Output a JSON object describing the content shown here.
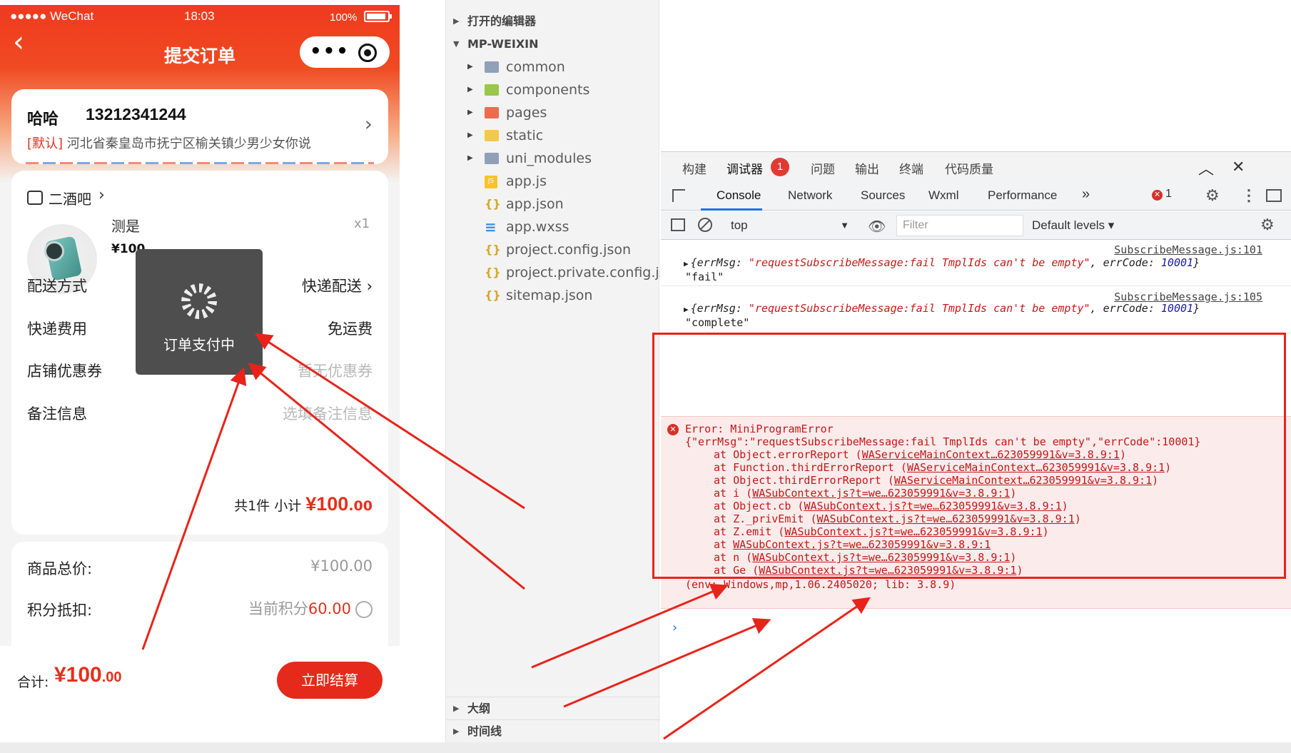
{
  "phone": {
    "status_left": "●●●●● WeChat",
    "status_time": "18:03",
    "status_battery": "100%",
    "nav_back": "‹",
    "nav_title": "提交订单",
    "capsule_more": "•••",
    "address": {
      "name": "哈哈",
      "phone": "13212341244",
      "default_tag": "[默认]",
      "detail": "河北省秦皇岛市抚宁区榆关镇少男少女你说",
      "chevron": "›"
    },
    "shop": {
      "name": "二酒吧",
      "chevron": "›"
    },
    "product": {
      "name": "测是",
      "qty": "x1",
      "price": "¥100"
    },
    "rows": [
      {
        "label": "配送方式",
        "value": "快递配送 ›"
      },
      {
        "label": "快递费用",
        "value": "免运费"
      },
      {
        "label": "店铺优惠券",
        "value": "暂无优惠券"
      },
      {
        "label": "备注信息",
        "value": "选填备注信息"
      }
    ],
    "subtotal": {
      "prefix": "共1件 小计 ",
      "amount": "¥100",
      "decimal": ".00"
    },
    "totals": [
      {
        "label": "商品总价:",
        "value": "¥100.00"
      },
      {
        "label": "积分抵扣:",
        "value_prefix": "当前积分",
        "value_points": "60.00"
      }
    ],
    "footer": {
      "label": "合计:",
      "amount": "¥100",
      "decimal": ".00",
      "pay_button": "立即结算"
    },
    "toast": {
      "text": "订单支付中"
    }
  },
  "explorer": {
    "sections": {
      "open_editors": "打开的编辑器",
      "project": "MP-WEIXIN",
      "outline": "大纲",
      "timeline": "时间线"
    },
    "items": [
      {
        "label": "common",
        "icon": "folder-icon",
        "folder": true
      },
      {
        "label": "components",
        "icon": "components-folder-icon",
        "folder": true
      },
      {
        "label": "pages",
        "icon": "pages-folder-icon",
        "folder": true
      },
      {
        "label": "static",
        "icon": "static-folder-icon",
        "folder": true
      },
      {
        "label": "uni_modules",
        "icon": "folder-icon",
        "folder": true
      },
      {
        "label": "app.js",
        "icon": "js-file-icon",
        "folder": false
      },
      {
        "label": "app.json",
        "icon": "json-file-icon",
        "folder": false
      },
      {
        "label": "app.wxss",
        "icon": "css-file-icon",
        "folder": false
      },
      {
        "label": "project.config.json",
        "icon": "json-file-icon",
        "folder": false
      },
      {
        "label": "project.private.config.js...",
        "icon": "json-file-icon",
        "folder": false
      },
      {
        "label": "sitemap.json",
        "icon": "json-file-icon",
        "folder": false
      }
    ]
  },
  "devtools": {
    "top_tabs": [
      "构建",
      "调试器",
      "问题",
      "输出",
      "终端",
      "代码质量"
    ],
    "top_badge": "1",
    "tabs": [
      "Console",
      "Network",
      "Sources",
      "Wxml",
      "Performance"
    ],
    "more_tabs": "»",
    "error_count": "1",
    "context": "top",
    "filter_placeholder": "Filter",
    "levels": "Default levels ▾",
    "logs": [
      {
        "source": "SubscribeMessage.js:101",
        "obj_open": "{errMsg: ",
        "errmsg": "\"requestSubscribeMessage:fail TmplIds can't be empty\"",
        "errcode_key": ", errCode: ",
        "errcode": "10001",
        "obj_close": "}",
        "value": "\"fail\""
      },
      {
        "source": "SubscribeMessage.js:105",
        "obj_open": "{errMsg: ",
        "errmsg": "\"requestSubscribeMessage:fail TmplIds can't be empty\"",
        "errcode_key": ", errCode: ",
        "errcode": "10001",
        "obj_close": "}",
        "value": "\"complete\""
      }
    ],
    "error": {
      "title": "Error: MiniProgramError",
      "message": "{\"errMsg\":\"requestSubscribeMessage:fail TmplIds can't be empty\",\"errCode\":10001}",
      "frames": [
        {
          "fn": "at Object.errorReport (",
          "loc": "WAServiceMainContext…623059991&v=3.8.9:1",
          "end": ")"
        },
        {
          "fn": "at Function.thirdErrorReport (",
          "loc": "WAServiceMainContext…623059991&v=3.8.9:1",
          "end": ")"
        },
        {
          "fn": "at Object.thirdErrorReport (",
          "loc": "WAServiceMainContext…623059991&v=3.8.9:1",
          "end": ")"
        },
        {
          "fn": "at i (",
          "loc": "WASubContext.js?t=we…623059991&v=3.8.9:1",
          "end": ")"
        },
        {
          "fn": "at Object.cb (",
          "loc": "WASubContext.js?t=we…623059991&v=3.8.9:1",
          "end": ")"
        },
        {
          "fn": "at Z._privEmit (",
          "loc": "WASubContext.js?t=we…623059991&v=3.8.9:1",
          "end": ")"
        },
        {
          "fn": "at Z.emit (",
          "loc": "WASubContext.js?t=we…623059991&v=3.8.9:1",
          "end": ")"
        },
        {
          "fn": "at ",
          "loc": "WASubContext.js?t=we…623059991&v=3.8.9:1",
          "end": ""
        },
        {
          "fn": "at n (",
          "loc": "WASubContext.js?t=we…623059991&v=3.8.9:1",
          "end": ")"
        },
        {
          "fn": "at Ge (",
          "loc": "WASubContext.js?t=we…623059991&v=3.8.9:1",
          "end": ")"
        }
      ],
      "env": "(env: Windows,mp,1.06.2405020; lib: 3.8.9)"
    },
    "prompt": "›"
  },
  "colors": {
    "brand_red": "#e3301c",
    "highlight_red": "#e8231a",
    "error_bg": "#fcebeb",
    "link_blue": "#1a73e8"
  }
}
